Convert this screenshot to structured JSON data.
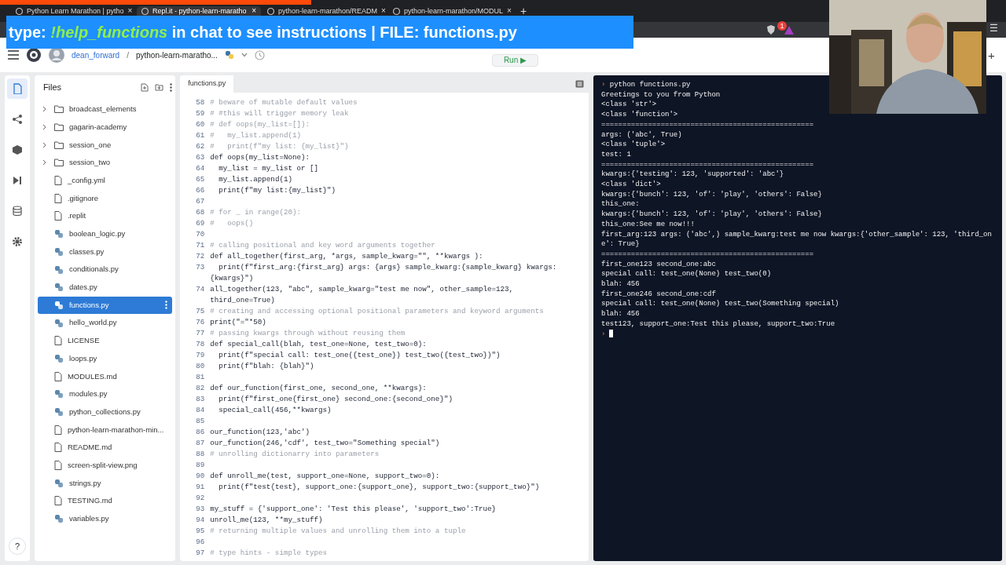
{
  "browser": {
    "tabs": [
      {
        "label": "Python Learn Marathon | pytho",
        "close": "×",
        "selected": false
      },
      {
        "label": "Repl.it - python-learn-maratho",
        "close": "×",
        "selected": true
      },
      {
        "label": "python-learn-marathon/READM",
        "close": "×",
        "selected": false
      },
      {
        "label": "python-learn-marathon/MODUL",
        "close": "×",
        "selected": false
      }
    ],
    "new_tab": "+",
    "menu": "☰",
    "notification_count": "1"
  },
  "banner": {
    "parts": [
      {
        "text": "type: ",
        "kind": "plain"
      },
      {
        "text": "!help_functions",
        "kind": "command"
      },
      {
        "text": " in chat to see instructions | FILE: functions.py",
        "kind": "plain"
      }
    ]
  },
  "header": {
    "user": "dean_forward",
    "separator": "/",
    "repl": "python-learn-maratho...",
    "run": "Run ▶",
    "add": "+"
  },
  "files": {
    "title": "Files",
    "items": [
      {
        "name": "broadcast_elements",
        "kind": "folder",
        "selected": false
      },
      {
        "name": "gagarin-academy",
        "kind": "folder",
        "selected": false
      },
      {
        "name": "session_one",
        "kind": "folder",
        "selected": false
      },
      {
        "name": "session_two",
        "kind": "folder",
        "selected": false
      },
      {
        "name": "_config.yml",
        "kind": "file",
        "selected": false
      },
      {
        "name": ".gitignore",
        "kind": "file",
        "selected": false
      },
      {
        "name": ".replit",
        "kind": "file",
        "selected": false
      },
      {
        "name": "boolean_logic.py",
        "kind": "python",
        "selected": false
      },
      {
        "name": "classes.py",
        "kind": "python",
        "selected": false
      },
      {
        "name": "conditionals.py",
        "kind": "python",
        "selected": false
      },
      {
        "name": "dates.py",
        "kind": "python",
        "selected": false
      },
      {
        "name": "functions.py",
        "kind": "python",
        "selected": true
      },
      {
        "name": "hello_world.py",
        "kind": "python",
        "selected": false
      },
      {
        "name": "LICENSE",
        "kind": "file",
        "selected": false
      },
      {
        "name": "loops.py",
        "kind": "python",
        "selected": false
      },
      {
        "name": "MODULES.md",
        "kind": "file",
        "selected": false
      },
      {
        "name": "modules.py",
        "kind": "python",
        "selected": false
      },
      {
        "name": "python_collections.py",
        "kind": "python",
        "selected": false
      },
      {
        "name": "python-learn-marathon-min...",
        "kind": "file",
        "selected": false
      },
      {
        "name": "README.md",
        "kind": "file",
        "selected": false
      },
      {
        "name": "screen-split-view.png",
        "kind": "file",
        "selected": false
      },
      {
        "name": "strings.py",
        "kind": "python",
        "selected": false
      },
      {
        "name": "TESTING.md",
        "kind": "file",
        "selected": false
      },
      {
        "name": "variables.py",
        "kind": "python",
        "selected": false
      }
    ],
    "help": "?"
  },
  "editor": {
    "tab": "functions.py",
    "lines": [
      {
        "number": "58",
        "kind": "comment",
        "text": "# beware of mutable default values"
      },
      {
        "number": "59",
        "kind": "comment",
        "text": "# #this will trigger memory leak"
      },
      {
        "number": "60",
        "kind": "comment",
        "text": "# def oops(my_list=[]):"
      },
      {
        "number": "61",
        "kind": "comment",
        "text": "#   my_list.append(1)"
      },
      {
        "number": "62",
        "kind": "comment",
        "text": "#   print(f\"my list: {my_list}\")"
      },
      {
        "number": "63",
        "kind": "code",
        "text": "def oops(my_list=None):"
      },
      {
        "number": "64",
        "kind": "code",
        "text": "  my_list = my_list or []"
      },
      {
        "number": "65",
        "kind": "code",
        "text": "  my_list.append(1)"
      },
      {
        "number": "66",
        "kind": "code",
        "text": "  print(f\"my list:{my_list}\")"
      },
      {
        "number": "67",
        "kind": "blank"
      },
      {
        "number": "68",
        "kind": "comment",
        "text": "# for _ in range(20):"
      },
      {
        "number": "69",
        "kind": "comment",
        "text": "#   oops()"
      },
      {
        "number": "70",
        "kind": "blank"
      },
      {
        "number": "71",
        "kind": "comment",
        "text": "# calling positional and key word arguments together"
      },
      {
        "number": "72",
        "kind": "code",
        "text": "def all_together(first_arg, *args, sample_kwarg=\"\", **kwargs ):"
      },
      {
        "number": "73",
        "kind": "code",
        "text": "  print(f\"first_arg:{first_arg} args: {args} sample_kwarg:{sample_kwarg} kwargs:{kwargs}\")"
      },
      {
        "number": "74",
        "kind": "code",
        "text": "all_together(123, \"abc\", sample_kwarg=\"test me now\", other_sample=123, third_one=True)"
      },
      {
        "number": "75",
        "kind": "comment",
        "text": "# creating and accessing optional positional parameters and keyword arguments"
      },
      {
        "number": "76",
        "kind": "code",
        "text": "print(\"=\"*50)"
      },
      {
        "number": "77",
        "kind": "comment",
        "text": "# passing kwargs through without reusing them"
      },
      {
        "number": "78",
        "kind": "code",
        "text": "def special_call(blah, test_one=None, test_two=0):"
      },
      {
        "number": "79",
        "kind": "code",
        "text": "  print(f\"special call: test_one({test_one}) test_two({test_two})\")"
      },
      {
        "number": "80",
        "kind": "code",
        "text": "  print(f\"blah: {blah}\")"
      },
      {
        "number": "81",
        "kind": "blank"
      },
      {
        "number": "82",
        "kind": "code",
        "text": "def our_function(first_one, second_one, **kwargs):"
      },
      {
        "number": "83",
        "kind": "code",
        "text": "  print(f\"first_one{first_one} second_one:{second_one}\")"
      },
      {
        "number": "84",
        "kind": "code",
        "text": "  special_call(456,**kwargs)"
      },
      {
        "number": "85",
        "kind": "blank"
      },
      {
        "number": "86",
        "kind": "code",
        "text": "our_function(123,'abc')"
      },
      {
        "number": "87",
        "kind": "code",
        "text": "our_function(246,'cdf', test_two=\"Something special\")"
      },
      {
        "number": "88",
        "kind": "comment",
        "text": "# unrolling dictionarry into parameters"
      },
      {
        "number": "89",
        "kind": "blank"
      },
      {
        "number": "90",
        "kind": "code",
        "text": "def unroll_me(test, support_one=None, support_two=0):"
      },
      {
        "number": "91",
        "kind": "code",
        "text": "  print(f\"test{test}, support_one:{support_one}, support_two:{support_two}\")"
      },
      {
        "number": "92",
        "kind": "blank"
      },
      {
        "number": "93",
        "kind": "code",
        "text": "my_stuff = {'support_one': 'Test this please', 'support_two':True}"
      },
      {
        "number": "94",
        "kind": "code",
        "text": "unroll_me(123, **my_stuff)"
      },
      {
        "number": "95",
        "kind": "comment",
        "text": "# returning multiple values and unrolling them into a tuple"
      },
      {
        "number": "96",
        "kind": "blank"
      },
      {
        "number": "97",
        "kind": "comment",
        "text": "# type hints - simple types"
      }
    ]
  },
  "console": {
    "prompt": "›",
    "command": "python functions.py",
    "output": [
      "Greetings to you from Python",
      "<class 'str'>",
      "<class 'function'>",
      "==================================================",
      "args: ('abc', True)",
      "<class 'tuple'>",
      "test: 1",
      "==================================================",
      "kwargs:{'testing': 123, 'supported': 'abc'}",
      "<class 'dict'>",
      "kwargs:{'bunch': 123, 'of': 'play', 'others': False}",
      "this_one:",
      "kwargs:{'bunch': 123, 'of': 'play', 'others': False}",
      "this_one:See me now!!!",
      "first_arg:123 args: ('abc',) sample_kwarg:test me now kwargs:{'other_sample': 123, 'third_one': True}",
      "==================================================",
      "first_one123 second_one:abc",
      "special call: test_one(None) test_two(0)",
      "blah: 456",
      "first_one246 second_one:cdf",
      "special call: test_one(None) test_two(Something special)",
      "blah: 456",
      "test123, support_one:Test this please, support_two:True"
    ]
  }
}
